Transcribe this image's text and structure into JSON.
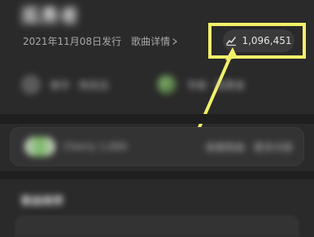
{
  "header": {
    "title_blurred": "孤勇者",
    "release_text": "2021年11月08日发行",
    "song_details_link": "歌曲详情"
  },
  "stats": {
    "play_count": "1,096,451",
    "play_icon": "trend-chart-icon"
  },
  "artists": {
    "left_label": "歌手 · 陈奕迅",
    "right_label": "专辑 · 孤勇者"
  },
  "card": {
    "left_text": "Cherry 1,000",
    "right_text": "查看歌曲 · 更多内容"
  },
  "bottom": {
    "section_title": "歌曲推荐"
  },
  "colors": {
    "background": "#2a2a2a",
    "separator": "#1f1f1f",
    "annotation": "#f3f16a"
  }
}
